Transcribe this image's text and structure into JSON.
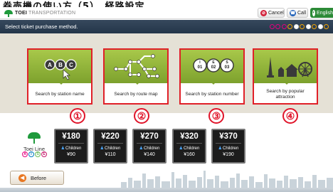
{
  "header_strip_text": "券売機の使い方（5）　経路設定",
  "brand": {
    "name": "TOEI",
    "sub": "TRANSPORTATION"
  },
  "header_buttons": {
    "cancel": "Cancel",
    "call": "Call",
    "english": "English"
  },
  "title": "Select ticket purchase method.",
  "progress_dots": [
    "#e6007e",
    "#e6007e",
    "#e6007e",
    "#f7a600",
    "#ffffff",
    "#f7a600",
    "#ffffff",
    "#f7a600",
    "#ffffff",
    "#f7a600"
  ],
  "options": [
    {
      "label": "Search by station name",
      "marker": "①",
      "icon": "station-name-icon"
    },
    {
      "label": "Search by route map",
      "marker": "②",
      "icon": "route-map-icon"
    },
    {
      "label": "Search by station number",
      "marker": "③",
      "icon": "station-number-icon"
    },
    {
      "label": "Search by popular attraction",
      "marker": "④",
      "icon": "popular-attraction-icon"
    }
  ],
  "station_bubbles": [
    "A",
    "B",
    "C"
  ],
  "station_numbers": [
    "01",
    "02",
    "03"
  ],
  "station_number_prefixes": [
    "I",
    "E",
    "S"
  ],
  "line": {
    "name": "Toei Line",
    "icons": [
      {
        "letter": "A",
        "color": "#e6007e"
      },
      {
        "letter": "I",
        "color": "#0079c2"
      },
      {
        "letter": "S",
        "color": "#6cbb5a"
      },
      {
        "letter": "E",
        "color": "#c6196c"
      }
    ]
  },
  "children_label": "Children",
  "fares": [
    {
      "adult": "¥180",
      "child": "¥90"
    },
    {
      "adult": "¥220",
      "child": "¥110"
    },
    {
      "adult": "¥270",
      "child": "¥140"
    },
    {
      "adult": "¥320",
      "child": "¥160"
    },
    {
      "adult": "¥370",
      "child": "¥190"
    }
  ],
  "before_label": "Before",
  "colors": {
    "highlight": "#e02028",
    "title_bar": "#2e4054",
    "card_green": "#8ab33a",
    "fare_bg": "#1c1c1c"
  }
}
